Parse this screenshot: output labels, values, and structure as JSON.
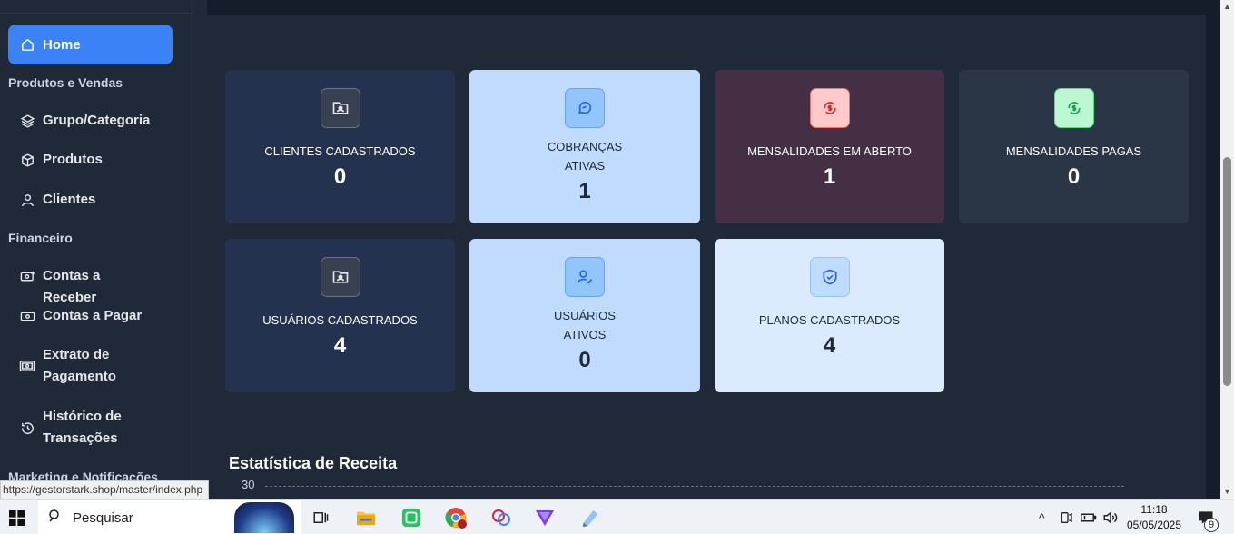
{
  "sidebar": {
    "home_label": "Home",
    "sections": {
      "produtos": "Produtos e Vendas",
      "financeiro": "Financeiro",
      "marketing": "Marketing e Notificações"
    },
    "items": {
      "grupo": "Grupo/Categoria",
      "produtos": "Produtos",
      "clientes": "Clientes",
      "receber": "Contas a Receber",
      "pagar": "Contas a Pagar",
      "extrato": "Extrato de Pagamento",
      "historico": "Histórico de Transações"
    }
  },
  "cards": {
    "clientes": {
      "title": "CLIENTES CADASTRADOS",
      "value": "0"
    },
    "cobrancas": {
      "title_line1": "COBRANÇAS",
      "title_line2": "ATIVAS",
      "value": "1"
    },
    "aberto": {
      "title": "MENSALIDADES EM ABERTO",
      "value": "1"
    },
    "pagas": {
      "title": "MENSALIDADES PAGAS",
      "value": "0"
    },
    "usuarios": {
      "title": "USUÁRIOS CADASTRADOS",
      "value": "4"
    },
    "ativos": {
      "title_line1": "USUÁRIOS",
      "title_line2": "ATIVOS",
      "value": "0"
    },
    "planos": {
      "title": "PLANOS CADASTRADOS",
      "value": "4"
    }
  },
  "stats": {
    "title": "Estatística de Receita",
    "y_top_label": "30"
  },
  "status_url": "https://gestorstark.shop/master/index.php",
  "taskbar": {
    "search_placeholder": "Pesquisar",
    "time": "11:18",
    "date": "05/05/2025",
    "notification_count": "9"
  },
  "colors": {
    "accent": "#3b82f6",
    "dark_card": "#24324f",
    "light_card": "#c0dbfd",
    "maroon_card": "#452f45",
    "slate_card": "#2a3646"
  }
}
